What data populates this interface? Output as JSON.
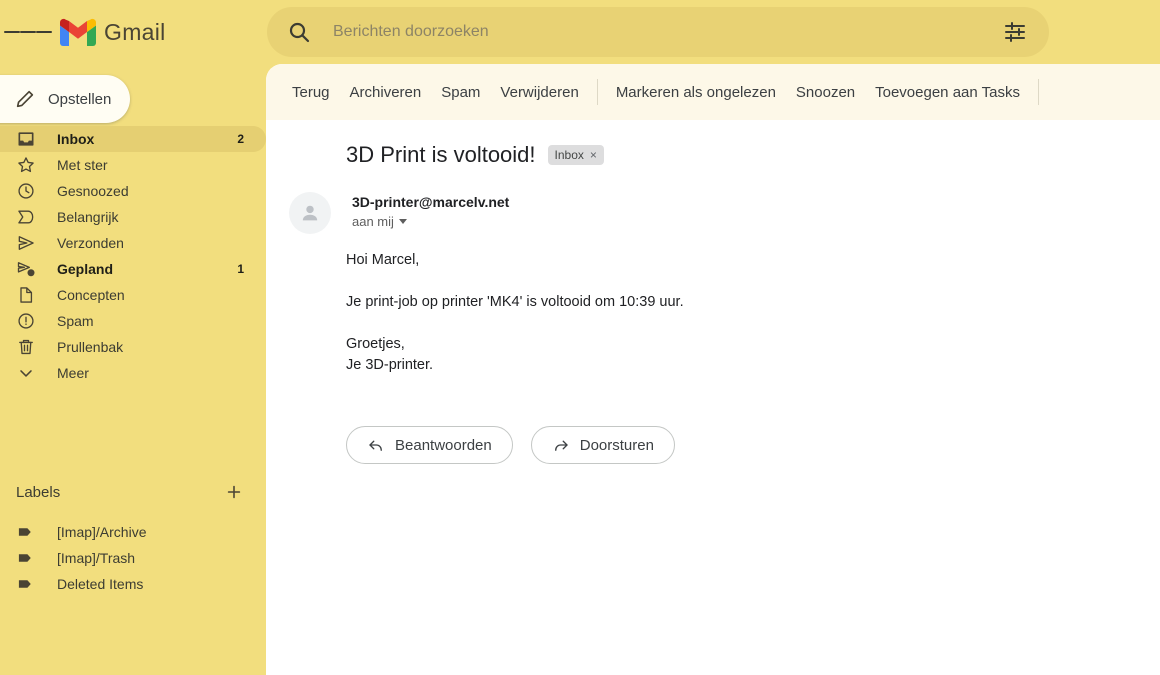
{
  "app": {
    "brand": "Gmail",
    "menu_icon": "hamburger-menu-icon",
    "logo_icon": "gmail-m-logo-icon"
  },
  "search": {
    "placeholder": "Berichten doorzoeken",
    "value": "",
    "search_icon": "search-icon",
    "filter_icon": "tune-filter-icon"
  },
  "sidebar": {
    "compose": {
      "label": "Opstellen",
      "icon": "pencil-icon"
    },
    "items": [
      {
        "label": "Inbox",
        "count": "2",
        "icon": "inbox-icon",
        "active": true,
        "bold": true
      },
      {
        "label": "Met ster",
        "count": "",
        "icon": "star-icon",
        "active": false,
        "bold": false
      },
      {
        "label": "Gesnoozed",
        "count": "",
        "icon": "clock-icon",
        "active": false,
        "bold": false
      },
      {
        "label": "Belangrijk",
        "count": "",
        "icon": "important-icon",
        "active": false,
        "bold": false
      },
      {
        "label": "Verzonden",
        "count": "",
        "icon": "send-icon",
        "active": false,
        "bold": false
      },
      {
        "label": "Gepland",
        "count": "1",
        "icon": "scheduled-icon",
        "active": false,
        "bold": true
      },
      {
        "label": "Concepten",
        "count": "",
        "icon": "draft-icon",
        "active": false,
        "bold": false
      },
      {
        "label": "Spam",
        "count": "",
        "icon": "spam-icon",
        "active": false,
        "bold": false
      },
      {
        "label": "Prullenbak",
        "count": "",
        "icon": "trash-icon",
        "active": false,
        "bold": false
      },
      {
        "label": "Meer",
        "count": "",
        "icon": "chevron-down-icon",
        "active": false,
        "bold": false
      }
    ],
    "labels_header": {
      "title": "Labels",
      "add_icon": "plus-icon"
    },
    "labels": [
      {
        "label": "[Imap]/Archive",
        "icon": "label-tag-icon"
      },
      {
        "label": "[Imap]/Trash",
        "icon": "label-tag-icon"
      },
      {
        "label": "Deleted Items",
        "icon": "label-tag-icon"
      }
    ]
  },
  "toolbar": {
    "items": [
      {
        "label": "Terug"
      },
      {
        "label": "Archiveren"
      },
      {
        "label": "Spam"
      },
      {
        "label": "Verwijderen"
      },
      {
        "sep": true
      },
      {
        "label": "Markeren als ongelezen"
      },
      {
        "label": "Snoozen"
      },
      {
        "label": "Toevoegen aan Tasks"
      },
      {
        "sep": true
      }
    ]
  },
  "mail": {
    "subject": "3D Print is voltooid!",
    "chip": {
      "label": "Inbox",
      "close": "×"
    },
    "sender": "3D-printer@marcelv.net",
    "to_line": "aan mij",
    "avatar_icon": "person-avatar-icon",
    "body": "Hoi Marcel,\n\nJe print-job op printer 'MK4' is voltooid om 10:39 uur.\n\nGroetjes,\nJe 3D-printer.",
    "actions": [
      {
        "label": "Beantwoorden",
        "icon": "reply-arrow-icon"
      },
      {
        "label": "Doorsturen",
        "icon": "forward-arrow-icon"
      }
    ]
  },
  "colors": {
    "sidebar_bg": "#f2de7e",
    "search_bg": "#e8d274",
    "active_pill": "#e5cf72",
    "toolbar_bg": "#fdf8e8",
    "content_bg": "#ffffff"
  }
}
